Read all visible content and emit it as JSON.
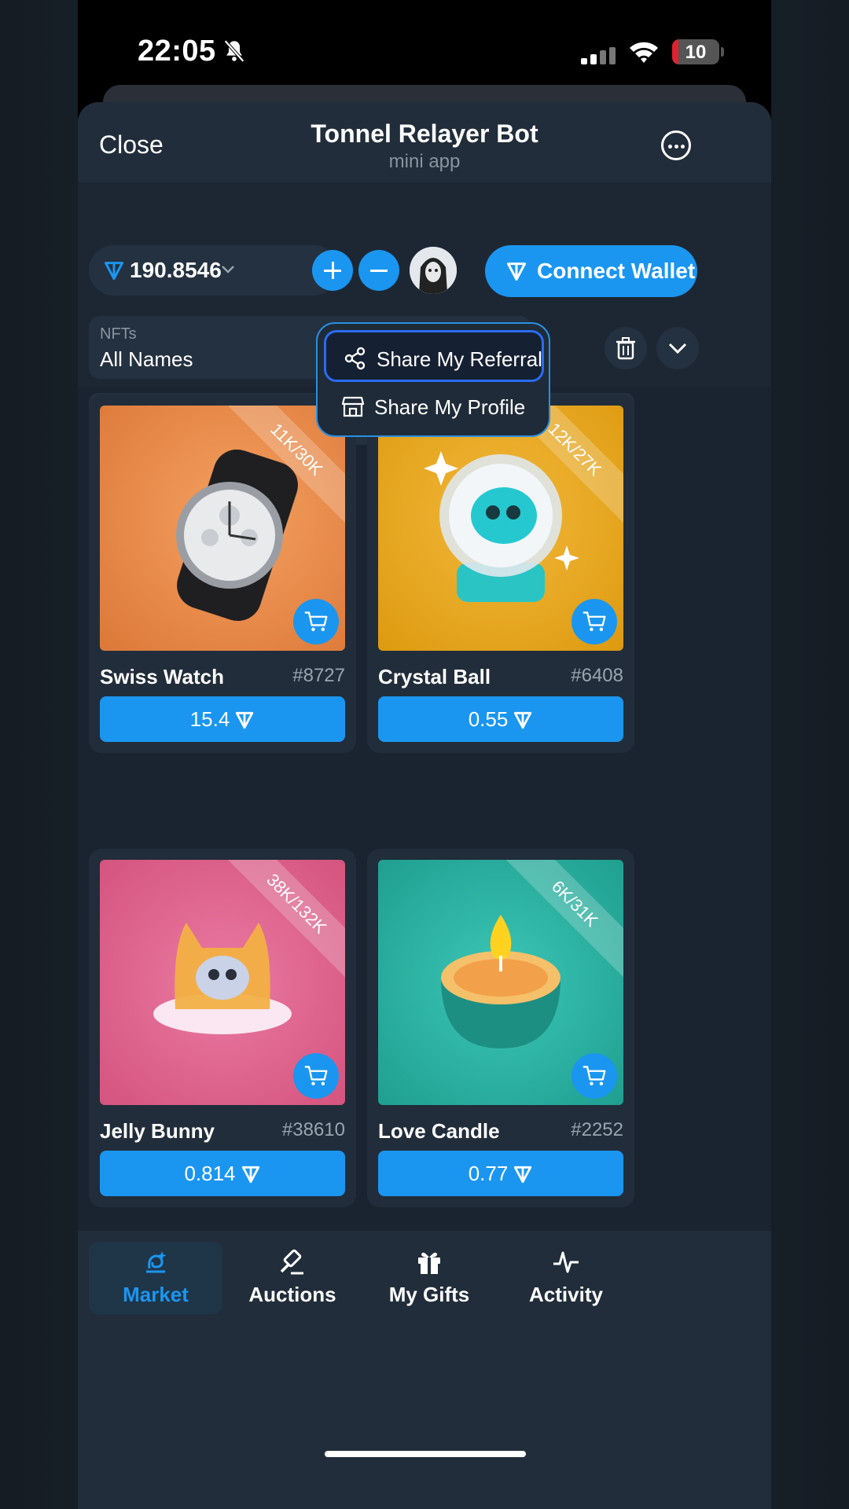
{
  "status_bar": {
    "time": "22:05",
    "battery": "10"
  },
  "header": {
    "close": "Close",
    "title": "Tonnel Relayer Bot",
    "subtitle": "mini app"
  },
  "wallet": {
    "balance": "190.8546",
    "connect_label": "Connect Wallet"
  },
  "filter": {
    "label": "NFTs",
    "value": "All Names"
  },
  "cart": {
    "count": "0"
  },
  "menu": {
    "items": [
      {
        "label": "Share My Referral",
        "icon": "share-icon"
      },
      {
        "label": "Share My Profile",
        "icon": "store-icon"
      }
    ]
  },
  "cards": [
    {
      "name": "Swiss Watch",
      "number": "#8727",
      "supply": "11K/30K",
      "price": "15.4",
      "bg": "#e8884a"
    },
    {
      "name": "Crystal Ball",
      "number": "#6408",
      "supply": "12K/27K",
      "price": "0.55",
      "bg": "#e8a820"
    },
    {
      "name": "Jelly Bunny",
      "number": "#38610",
      "supply": "38K/132K",
      "price": "0.814",
      "bg": "#e0608c"
    },
    {
      "name": "Love Candle",
      "number": "#2252",
      "supply": "6K/31K",
      "price": "0.77",
      "bg": "#2ab0a0"
    }
  ],
  "nav": {
    "items": [
      {
        "label": "Market",
        "icon": "market-icon",
        "active": true
      },
      {
        "label": "Auctions",
        "icon": "gavel-icon",
        "active": false
      },
      {
        "label": "My Gifts",
        "icon": "gift-icon",
        "active": false
      },
      {
        "label": "Activity",
        "icon": "activity-icon",
        "active": false
      }
    ]
  },
  "colors": {
    "accent": "#1a96f0",
    "background": "#1a2430",
    "surface": "#212d3a"
  }
}
